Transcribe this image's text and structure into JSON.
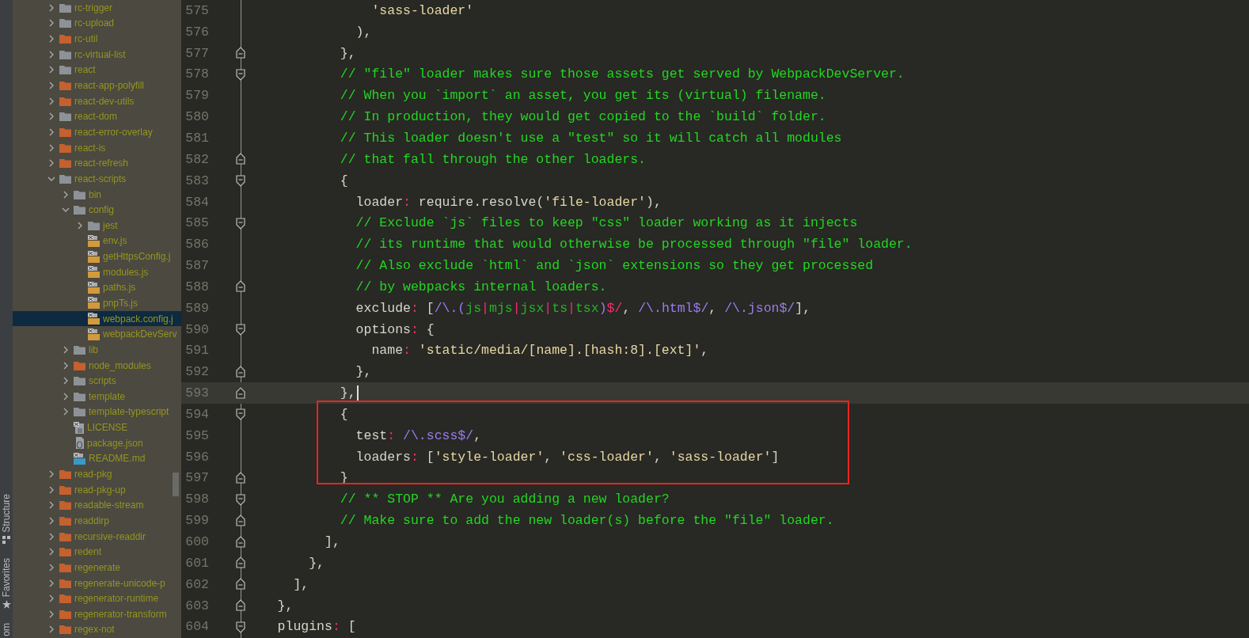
{
  "tool_strip": {
    "tabs": [
      {
        "label": "Structure",
        "kind": "structure"
      },
      {
        "label": "Favorites",
        "kind": "favorites"
      },
      {
        "label": "om",
        "kind": "plain"
      }
    ]
  },
  "project_tree": {
    "items": [
      {
        "label": "rc-trigger",
        "kind": "folder",
        "color": "#8d9297",
        "expanded": false,
        "selected": false
      },
      {
        "label": "rc-upload",
        "kind": "folder",
        "color": "#8d9297",
        "expanded": false,
        "selected": false
      },
      {
        "label": "rc-util",
        "kind": "folder",
        "color": "#c4612e",
        "expanded": false,
        "selected": false
      },
      {
        "label": "rc-virtual-list",
        "kind": "folder",
        "color": "#8d9297",
        "expanded": false,
        "selected": false
      },
      {
        "label": "react",
        "kind": "folder",
        "color": "#8d9297",
        "expanded": false,
        "selected": false
      },
      {
        "label": "react-app-polyfill",
        "kind": "folder",
        "color": "#c4612e",
        "expanded": false,
        "selected": false
      },
      {
        "label": "react-dev-utils",
        "kind": "folder",
        "color": "#c4612e",
        "expanded": false,
        "selected": false
      },
      {
        "label": "react-dom",
        "kind": "folder",
        "color": "#8d9297",
        "expanded": false,
        "selected": false
      },
      {
        "label": "react-error-overlay",
        "kind": "folder",
        "color": "#c4612e",
        "expanded": false,
        "selected": false
      },
      {
        "label": "react-is",
        "kind": "folder",
        "color": "#c4612e",
        "expanded": false,
        "selected": false
      },
      {
        "label": "react-refresh",
        "kind": "folder",
        "color": "#c4612e",
        "expanded": false,
        "selected": false
      },
      {
        "label": "react-scripts",
        "kind": "folder",
        "color": "#8d9297",
        "expanded": true,
        "selected": false,
        "children": [
          {
            "label": "bin",
            "kind": "folder",
            "color": "#8d9297",
            "expanded": false,
            "selected": false
          },
          {
            "label": "config",
            "kind": "folder",
            "color": "#8d9297",
            "expanded": true,
            "selected": false,
            "children": [
              {
                "label": "jest",
                "kind": "folder",
                "color": "#8d9297",
                "expanded": false,
                "selected": false
              },
              {
                "label": "env.js",
                "kind": "js",
                "selected": false
              },
              {
                "label": "getHttpsConfig.j",
                "kind": "js",
                "selected": false
              },
              {
                "label": "modules.js",
                "kind": "js",
                "selected": false
              },
              {
                "label": "paths.js",
                "kind": "js",
                "selected": false
              },
              {
                "label": "pnpTs.js",
                "kind": "js",
                "selected": false
              },
              {
                "label": "webpack.config.j",
                "kind": "js",
                "selected": true
              },
              {
                "label": "webpackDevServ",
                "kind": "js",
                "selected": false
              }
            ]
          },
          {
            "label": "lib",
            "kind": "folder",
            "color": "#8d9297",
            "expanded": false,
            "selected": false
          },
          {
            "label": "node_modules",
            "kind": "folder",
            "color": "#c4612e",
            "expanded": false,
            "selected": false
          },
          {
            "label": "scripts",
            "kind": "folder",
            "color": "#8d9297",
            "expanded": false,
            "selected": false
          },
          {
            "label": "template",
            "kind": "folder",
            "color": "#8d9297",
            "expanded": false,
            "selected": false
          },
          {
            "label": "template-typescript",
            "kind": "folder",
            "color": "#8d9297",
            "expanded": false,
            "selected": false
          },
          {
            "label": "LICENSE",
            "kind": "text",
            "selected": false
          },
          {
            "label": "package.json",
            "kind": "json",
            "selected": false
          },
          {
            "label": "README.md",
            "kind": "md",
            "selected": false
          }
        ]
      },
      {
        "label": "read-pkg",
        "kind": "folder",
        "color": "#c4612e",
        "expanded": false,
        "selected": false
      },
      {
        "label": "read-pkg-up",
        "kind": "folder",
        "color": "#c4612e",
        "expanded": false,
        "selected": false
      },
      {
        "label": "readable-stream",
        "kind": "folder",
        "color": "#c4612e",
        "expanded": false,
        "selected": false
      },
      {
        "label": "readdirp",
        "kind": "folder",
        "color": "#c4612e",
        "expanded": false,
        "selected": false
      },
      {
        "label": "recursive-readdir",
        "kind": "folder",
        "color": "#c4612e",
        "expanded": false,
        "selected": false
      },
      {
        "label": "redent",
        "kind": "folder",
        "color": "#c4612e",
        "expanded": false,
        "selected": false
      },
      {
        "label": "regenerate",
        "kind": "folder",
        "color": "#c4612e",
        "expanded": false,
        "selected": false
      },
      {
        "label": "regenerate-unicode-p",
        "kind": "folder",
        "color": "#c4612e",
        "expanded": false,
        "selected": false
      },
      {
        "label": "regenerator-runtime",
        "kind": "folder",
        "color": "#c4612e",
        "expanded": false,
        "selected": false
      },
      {
        "label": "regenerator-transform",
        "kind": "folder",
        "color": "#c4612e",
        "expanded": false,
        "selected": false
      },
      {
        "label": "regex-not",
        "kind": "folder",
        "color": "#c4612e",
        "expanded": false,
        "selected": false
      }
    ]
  },
  "editor": {
    "annotations": [
      {
        "kind": "rectangle",
        "color": "#e8261f"
      }
    ],
    "lines": [
      {
        "number": "575",
        "kind": "plain",
        "current": false,
        "boxed": false,
        "tokens": [
          {
            "kind": "string",
            "text": "                'sass-loader'"
          }
        ]
      },
      {
        "number": "576",
        "kind": "plain",
        "current": false,
        "boxed": false,
        "tokens": [
          {
            "kind": "plain",
            "text": "              ),"
          }
        ]
      },
      {
        "number": "577",
        "kind": "fold_end",
        "current": false,
        "boxed": false,
        "tokens": [
          {
            "kind": "plain",
            "text": "            },"
          }
        ]
      },
      {
        "number": "578",
        "kind": "fold_start",
        "current": false,
        "boxed": false,
        "tokens": [
          {
            "kind": "comment",
            "text": "            // \"file\" loader makes sure those assets get served by WebpackDevServer."
          }
        ]
      },
      {
        "number": "579",
        "kind": "plain",
        "current": false,
        "boxed": false,
        "tokens": [
          {
            "kind": "comment",
            "text": "            // When you `import` an asset, you get its (virtual) filename."
          }
        ]
      },
      {
        "number": "580",
        "kind": "plain",
        "current": false,
        "boxed": false,
        "tokens": [
          {
            "kind": "comment",
            "text": "            // In production, they would get copied to the `build` folder."
          }
        ]
      },
      {
        "number": "581",
        "kind": "plain",
        "current": false,
        "boxed": false,
        "tokens": [
          {
            "kind": "comment",
            "text": "            // This loader doesn't use a \"test\" so it will catch all modules"
          }
        ]
      },
      {
        "number": "582",
        "kind": "fold_end",
        "current": false,
        "boxed": false,
        "tokens": [
          {
            "kind": "comment",
            "text": "            // that fall through the other loaders."
          }
        ]
      },
      {
        "number": "583",
        "kind": "fold_start",
        "current": false,
        "boxed": false,
        "tokens": [
          {
            "kind": "plain",
            "text": "            {"
          }
        ]
      },
      {
        "number": "584",
        "kind": "plain",
        "current": false,
        "boxed": false,
        "tokens": [
          {
            "kind": "plain",
            "text": "              loader"
          },
          {
            "kind": "punct",
            "text": ":"
          },
          {
            "kind": "plain",
            "text": " require.resolve("
          },
          {
            "kind": "string",
            "text": "'file-loader'"
          },
          {
            "kind": "plain",
            "text": "),"
          }
        ]
      },
      {
        "number": "585",
        "kind": "fold_start",
        "current": false,
        "boxed": false,
        "tokens": [
          {
            "kind": "comment",
            "text": "              // Exclude `js` files to keep \"css\" loader working as it injects"
          }
        ]
      },
      {
        "number": "586",
        "kind": "plain",
        "current": false,
        "boxed": false,
        "tokens": [
          {
            "kind": "comment",
            "text": "              // its runtime that would otherwise be processed through \"file\" loader."
          }
        ]
      },
      {
        "number": "587",
        "kind": "plain",
        "current": false,
        "boxed": false,
        "tokens": [
          {
            "kind": "comment",
            "text": "              // Also exclude `html` and `json` extensions so they get processed"
          }
        ]
      },
      {
        "number": "588",
        "kind": "fold_end",
        "current": false,
        "boxed": false,
        "tokens": [
          {
            "kind": "comment",
            "text": "              // by webpacks internal loaders."
          }
        ]
      },
      {
        "number": "589",
        "kind": "plain",
        "current": false,
        "boxed": false,
        "tokens": [
          {
            "kind": "plain",
            "text": "              exclude"
          },
          {
            "kind": "punct",
            "text": ":"
          },
          {
            "kind": "plain",
            "text": " ["
          },
          {
            "kind": "regex",
            "text": "/\\.("
          },
          {
            "kind": "group",
            "text": "js"
          },
          {
            "kind": "punct",
            "text": "|"
          },
          {
            "kind": "group",
            "text": "mjs"
          },
          {
            "kind": "punct",
            "text": "|"
          },
          {
            "kind": "group",
            "text": "jsx"
          },
          {
            "kind": "punct",
            "text": "|"
          },
          {
            "kind": "group",
            "text": "ts"
          },
          {
            "kind": "punct",
            "text": "|"
          },
          {
            "kind": "group",
            "text": "tsx"
          },
          {
            "kind": "regex",
            "text": ")"
          },
          {
            "kind": "punct",
            "text": "$/"
          },
          {
            "kind": "plain",
            "text": ", "
          },
          {
            "kind": "regex",
            "text": "/\\.html$/"
          },
          {
            "kind": "plain",
            "text": ", "
          },
          {
            "kind": "regex",
            "text": "/\\.json$/"
          },
          {
            "kind": "plain",
            "text": "],"
          }
        ]
      },
      {
        "number": "590",
        "kind": "fold_start",
        "current": false,
        "boxed": false,
        "tokens": [
          {
            "kind": "plain",
            "text": "              options"
          },
          {
            "kind": "punct",
            "text": ":"
          },
          {
            "kind": "plain",
            "text": " {"
          }
        ]
      },
      {
        "number": "591",
        "kind": "plain",
        "current": false,
        "boxed": false,
        "tokens": [
          {
            "kind": "plain",
            "text": "                name"
          },
          {
            "kind": "punct",
            "text": ":"
          },
          {
            "kind": "string",
            "text": " 'static/media/[name].[hash:8].[ext]'"
          },
          {
            "kind": "plain",
            "text": ","
          }
        ]
      },
      {
        "number": "592",
        "kind": "fold_end",
        "current": false,
        "boxed": false,
        "tokens": [
          {
            "kind": "plain",
            "text": "              },"
          }
        ]
      },
      {
        "number": "593",
        "kind": "fold_end",
        "current": true,
        "boxed": false,
        "tokens": [
          {
            "kind": "plain",
            "text": "            },"
          }
        ]
      },
      {
        "number": "594",
        "kind": "fold_start",
        "current": false,
        "boxed": true,
        "tokens": [
          {
            "kind": "plain",
            "text": "            {"
          }
        ]
      },
      {
        "number": "595",
        "kind": "plain",
        "current": false,
        "boxed": true,
        "tokens": [
          {
            "kind": "plain",
            "text": "              test"
          },
          {
            "kind": "punct",
            "text": ":"
          },
          {
            "kind": "regex",
            "text": " /\\.scss$/"
          },
          {
            "kind": "plain",
            "text": ","
          }
        ]
      },
      {
        "number": "596",
        "kind": "plain",
        "current": false,
        "boxed": true,
        "tokens": [
          {
            "kind": "plain",
            "text": "              loaders"
          },
          {
            "kind": "punct",
            "text": ":"
          },
          {
            "kind": "plain",
            "text": " ["
          },
          {
            "kind": "string",
            "text": "'style-loader'"
          },
          {
            "kind": "plain",
            "text": ", "
          },
          {
            "kind": "string",
            "text": "'css-loader'"
          },
          {
            "kind": "plain",
            "text": ", "
          },
          {
            "kind": "string",
            "text": "'sass-loader'"
          },
          {
            "kind": "plain",
            "text": "]"
          }
        ]
      },
      {
        "number": "597",
        "kind": "fold_end",
        "current": false,
        "boxed": true,
        "tokens": [
          {
            "kind": "plain",
            "text": "            }"
          }
        ]
      },
      {
        "number": "598",
        "kind": "fold_start",
        "current": false,
        "boxed": false,
        "tokens": [
          {
            "kind": "comment",
            "text": "            // ** STOP ** Are you adding a new loader?"
          }
        ]
      },
      {
        "number": "599",
        "kind": "fold_end",
        "current": false,
        "boxed": false,
        "tokens": [
          {
            "kind": "comment",
            "text": "            // Make sure to add the new loader(s) before the \"file\" loader."
          }
        ]
      },
      {
        "number": "600",
        "kind": "fold_end",
        "current": false,
        "boxed": false,
        "tokens": [
          {
            "kind": "plain",
            "text": "          ],"
          }
        ]
      },
      {
        "number": "601",
        "kind": "fold_end",
        "current": false,
        "boxed": false,
        "tokens": [
          {
            "kind": "plain",
            "text": "        },"
          }
        ]
      },
      {
        "number": "602",
        "kind": "fold_end",
        "current": false,
        "boxed": false,
        "tokens": [
          {
            "kind": "plain",
            "text": "      ],"
          }
        ]
      },
      {
        "number": "603",
        "kind": "fold_end",
        "current": false,
        "boxed": false,
        "tokens": [
          {
            "kind": "plain",
            "text": "    },"
          }
        ]
      },
      {
        "number": "604",
        "kind": "fold_start",
        "current": false,
        "boxed": false,
        "tokens": [
          {
            "kind": "plain",
            "text": "    plugins"
          },
          {
            "kind": "punct",
            "text": ":"
          },
          {
            "kind": "plain",
            "text": " ["
          }
        ]
      }
    ]
  }
}
